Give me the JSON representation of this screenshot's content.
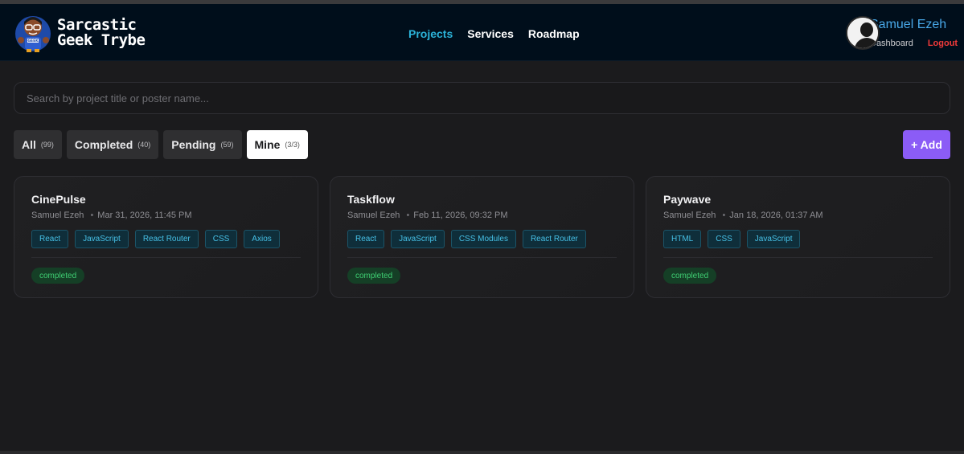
{
  "brand": {
    "line1": "Sarcastic",
    "line2": "Geek Trybe"
  },
  "nav": {
    "items": [
      "Projects",
      "Services",
      "Roadmap"
    ],
    "active": "Projects"
  },
  "user": {
    "name": "Samuel Ezeh",
    "dashboard": "Dashboard",
    "logout": "Logout"
  },
  "search": {
    "placeholder": "Search by project title or poster name...",
    "value": ""
  },
  "filters": [
    {
      "label": "All",
      "count": "(99)"
    },
    {
      "label": "Completed",
      "count": "(40)"
    },
    {
      "label": "Pending",
      "count": "(59)"
    },
    {
      "label": "Mine",
      "count": "(3/3)"
    }
  ],
  "active_filter": "Mine",
  "add_button": "+ Add",
  "projects": [
    {
      "title": "CinePulse",
      "author": "Samuel Ezeh",
      "date": "Mar 31, 2026, 11:45 PM",
      "tags": [
        "React",
        "JavaScript",
        "React Router",
        "CSS",
        "Axios"
      ],
      "status": "completed"
    },
    {
      "title": "Taskflow",
      "author": "Samuel Ezeh",
      "date": "Feb 11, 2026, 09:32 PM",
      "tags": [
        "React",
        "JavaScript",
        "CSS Modules",
        "React Router"
      ],
      "status": "completed"
    },
    {
      "title": "Paywave",
      "author": "Samuel Ezeh",
      "date": "Jan 18, 2026, 01:37 AM",
      "tags": [
        "HTML",
        "CSS",
        "JavaScript"
      ],
      "status": "completed"
    }
  ],
  "colors": {
    "header_bg": "#000e1b",
    "page_bg": "#1b1b1d",
    "accent_nav": "#2bb3d9",
    "add_button": "#8b5cf6",
    "logout": "#f23a3a",
    "status_completed": "#3fcf73"
  }
}
